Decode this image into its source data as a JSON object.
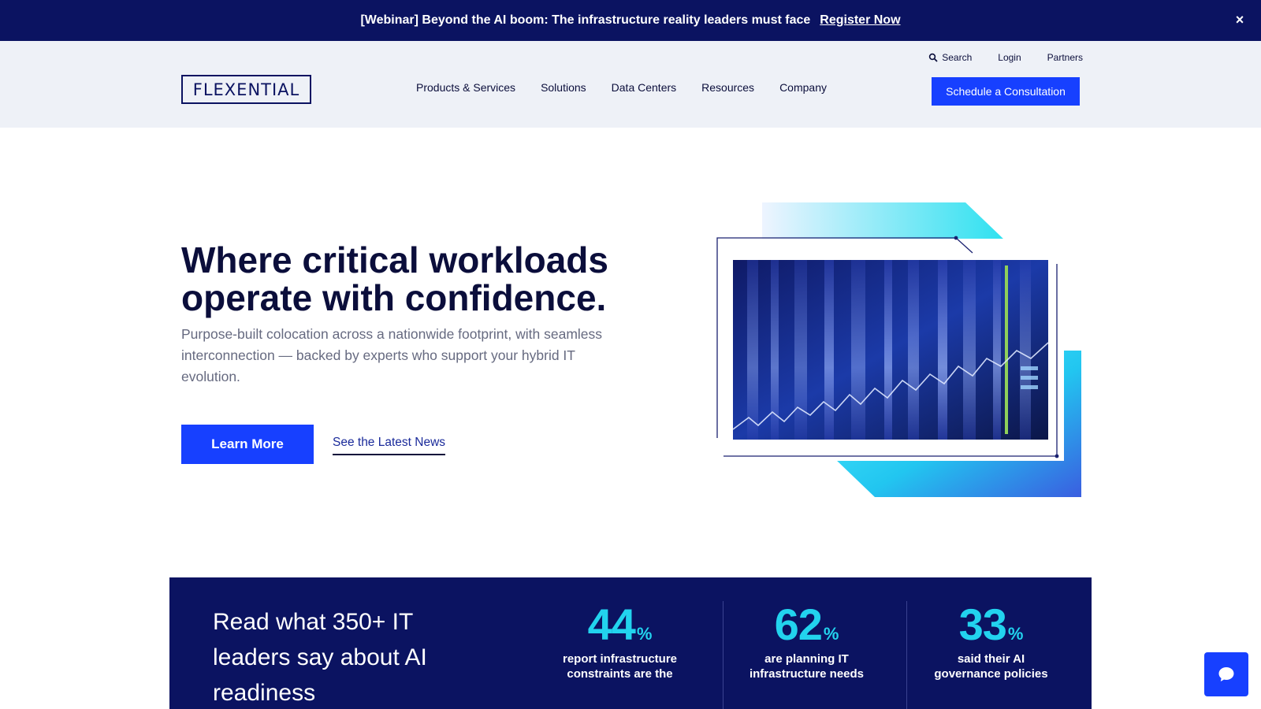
{
  "banner": {
    "text": "[Webinar] Beyond the AI boom: The infrastructure reality leaders must face",
    "link": "Register Now",
    "close": "×"
  },
  "header": {
    "logo": "FLEXENTIAL",
    "utility": [
      "Search",
      "Login",
      "Partners"
    ],
    "nav": [
      "Products & Services",
      "Solutions",
      "Data Centers",
      "Resources",
      "Company"
    ],
    "cta": "Schedule a Consultation"
  },
  "hero": {
    "title": "Where critical workloads operate with confidence.",
    "subtitle": "Purpose-built colocation across a nationwide footprint, with seamless interconnection — backed by experts who support your hybrid IT evolution.",
    "primary_button": "Learn More",
    "secondary_link": "See the Latest News"
  },
  "stats": {
    "heading": "Read what 350+ IT leaders say about AI readiness",
    "items": [
      {
        "value": "44",
        "unit": "%",
        "desc": "report infrastructure constraints are the"
      },
      {
        "value": "62",
        "unit": "%",
        "desc": "are planning IT infrastructure needs"
      },
      {
        "value": "33",
        "unit": "%",
        "desc": "said their AI governance policies"
      }
    ]
  },
  "colors": {
    "navy": "#0b1361",
    "accent_blue": "#1740ff",
    "cyan": "#22d3ee",
    "header_bg": "#eef1f7"
  },
  "icons": {
    "search": "search-icon",
    "close": "close-icon",
    "chat": "chat-icon"
  }
}
